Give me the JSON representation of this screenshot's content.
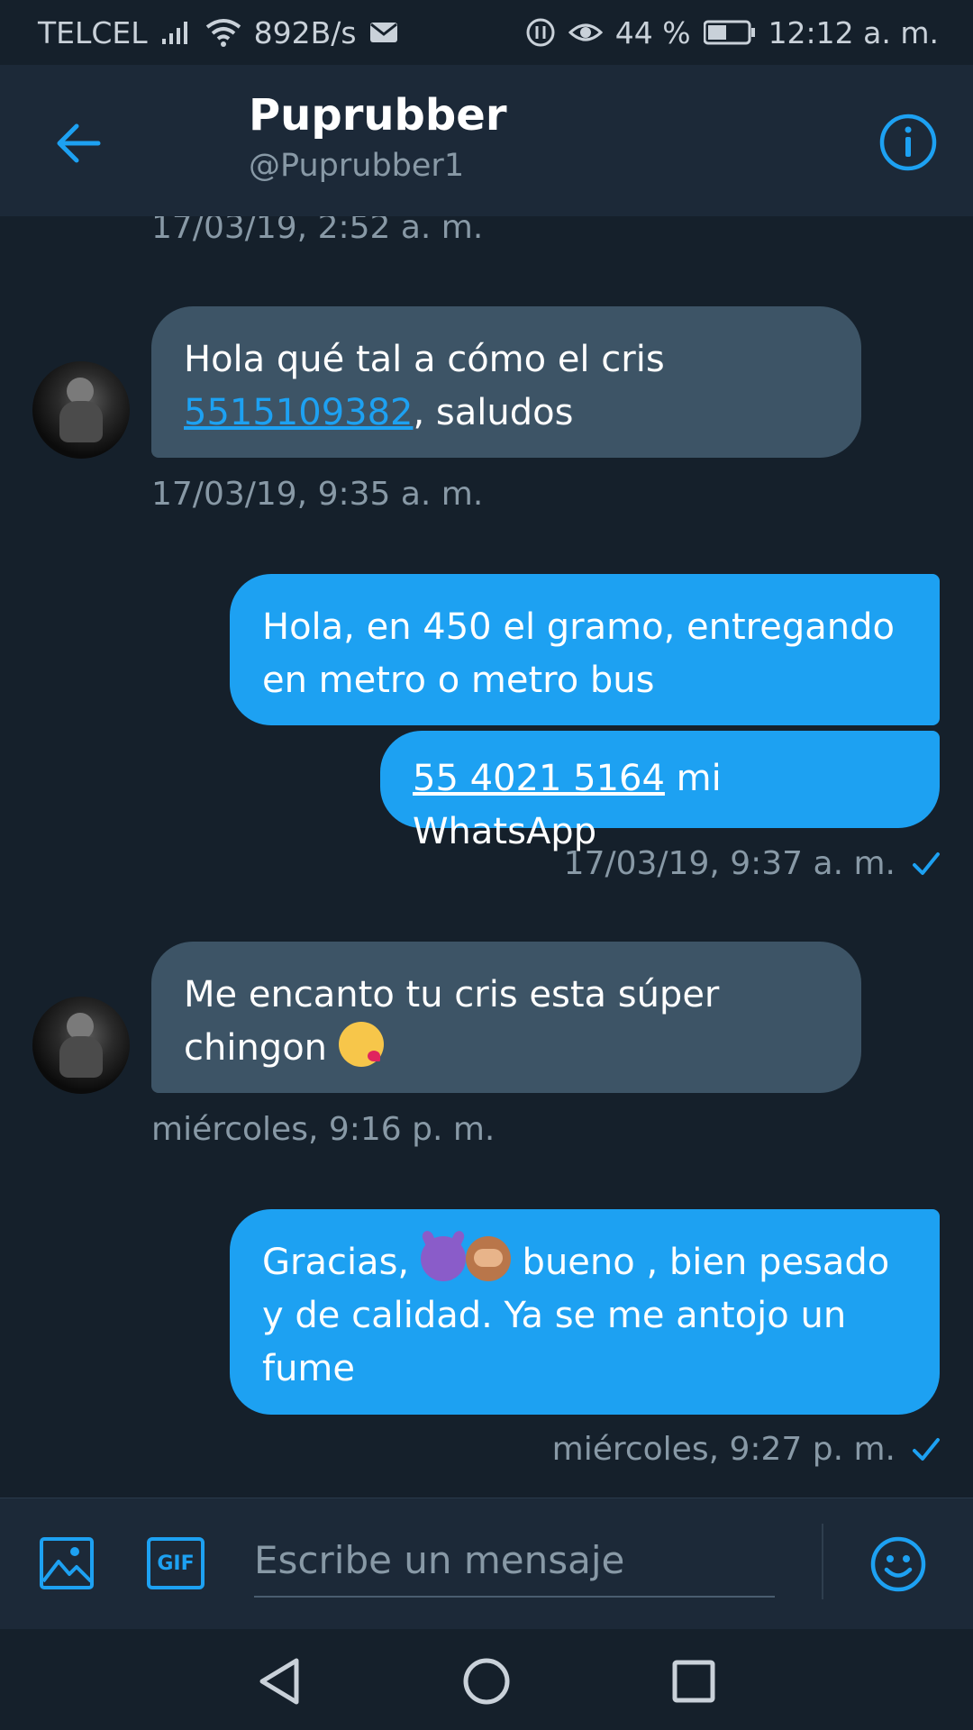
{
  "status_bar": {
    "carrier": "TELCEL",
    "speed": "892B/s",
    "battery": "44 %",
    "time": "12:12 a. m."
  },
  "header": {
    "name": "Puprubber",
    "handle": "@Puprubber1"
  },
  "messages": [
    {
      "type": "timestamp",
      "text": "17/03/19, 2:52 a. m."
    },
    {
      "type": "in",
      "parts": {
        "a": "Hola qué tal a cómo el cris",
        "link": "5515109382",
        "b": ", saludos"
      }
    },
    {
      "type": "timestamp",
      "text": "17/03/19, 9:35 a. m."
    },
    {
      "type": "out",
      "text": "Hola, en 450 el gramo, entregando en metro o metro bus"
    },
    {
      "type": "out",
      "parts": {
        "link": "55 4021 5164",
        "b": " mi WhatsApp"
      }
    },
    {
      "type": "timestamp",
      "text": "17/03/19, 9:37 a. m."
    },
    {
      "type": "in",
      "parts": {
        "a": "Me encanto tu cris esta súper chingon"
      }
    },
    {
      "type": "timestamp",
      "text": "miércoles, 9:16 p. m."
    },
    {
      "type": "out",
      "parts": {
        "a": "Gracias,",
        "b": " bueno , bien pesado y de calidad. Ya se me antojo un fume"
      }
    },
    {
      "type": "timestamp",
      "text": "miércoles, 9:27 p. m."
    }
  ],
  "composer": {
    "placeholder": "Escribe un mensaje",
    "gif_label": "GIF"
  },
  "colors": {
    "background": "#15202b",
    "header": "#1c2938",
    "accent": "#1da1f2",
    "incoming_bubble": "#3d5466",
    "muted_text": "#8899a6"
  },
  "icons": [
    "back-arrow-icon",
    "info-icon",
    "image-icon",
    "gif-icon",
    "emoji-icon",
    "nav-back-icon",
    "nav-home-icon",
    "nav-recents-icon",
    "read-check-icon"
  ]
}
